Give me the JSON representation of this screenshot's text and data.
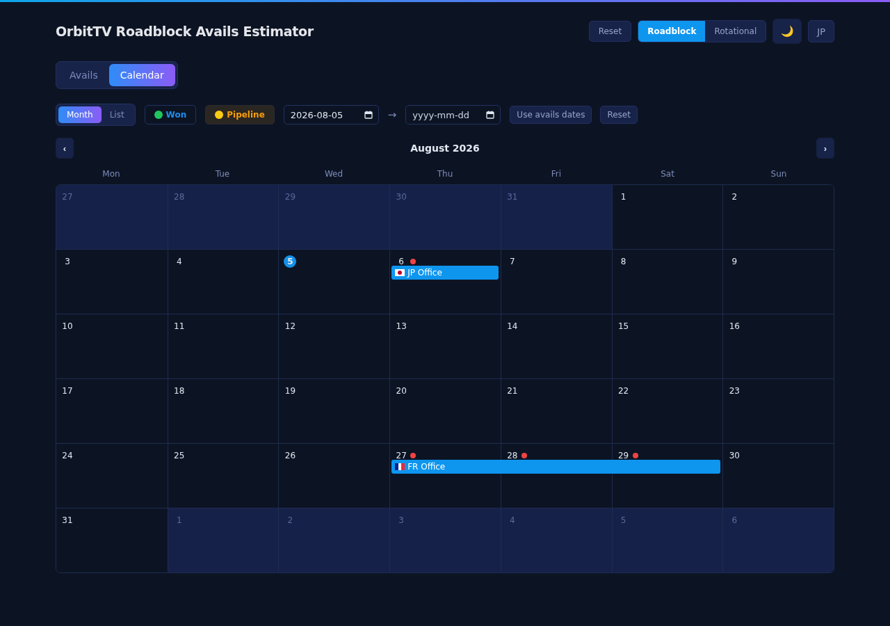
{
  "title": "OrbitTV Roadblock Avails Estimator",
  "header_actions": {
    "reset": "Reset",
    "modes": [
      {
        "label": "Roadblock",
        "selected": true
      },
      {
        "label": "Rotational",
        "selected": false
      }
    ],
    "theme_icon": "🌙",
    "language": "JP"
  },
  "main_tabs": [
    {
      "label": "Avails",
      "selected": false
    },
    {
      "label": "Calendar",
      "selected": true
    }
  ],
  "toolbar": {
    "views": [
      {
        "label": "Month",
        "selected": true
      },
      {
        "label": "List",
        "selected": false
      }
    ],
    "filters": [
      {
        "label": "Won",
        "color": "#22c55e",
        "kind": "won"
      },
      {
        "label": "Pipeline",
        "color": "#facc15",
        "kind": "pipeline"
      }
    ],
    "start_date": {
      "value": "2026-08-05"
    },
    "arrow": "→",
    "end_date": {
      "placeholder": "yyyy-mm-dd"
    },
    "use_avails": "Use avails dates",
    "reset": "Reset"
  },
  "calendar": {
    "prev": "‹",
    "next": "›",
    "month": "August 2026",
    "weekdays": [
      "Mon",
      "Tue",
      "Wed",
      "Thu",
      "Fri",
      "Sat",
      "Sun"
    ],
    "weeks": [
      {
        "days": [
          {
            "label": "27",
            "outside": true
          },
          {
            "label": "28",
            "outside": true
          },
          {
            "label": "29",
            "outside": true
          },
          {
            "label": "30",
            "outside": true
          },
          {
            "label": "31",
            "outside": true
          },
          {
            "label": "1",
            "outside": false
          },
          {
            "label": "2",
            "outside": false
          }
        ]
      },
      {
        "days": [
          {
            "label": "3",
            "outside": false
          },
          {
            "label": "4",
            "outside": false
          },
          {
            "label": "5",
            "outside": false,
            "today": true
          },
          {
            "label": "6",
            "outside": false,
            "marked": true
          },
          {
            "label": "7",
            "outside": false
          },
          {
            "label": "8",
            "outside": false
          },
          {
            "label": "9",
            "outside": false
          }
        ],
        "events": [
          {
            "label": "JP Office",
            "kind": "jp"
          }
        ]
      },
      {
        "days": [
          {
            "label": "10",
            "outside": false
          },
          {
            "label": "11",
            "outside": false
          },
          {
            "label": "12",
            "outside": false
          },
          {
            "label": "13",
            "outside": false
          },
          {
            "label": "14",
            "outside": false
          },
          {
            "label": "15",
            "outside": false
          },
          {
            "label": "16",
            "outside": false
          }
        ]
      },
      {
        "days": [
          {
            "label": "17",
            "outside": false
          },
          {
            "label": "18",
            "outside": false
          },
          {
            "label": "19",
            "outside": false
          },
          {
            "label": "20",
            "outside": false
          },
          {
            "label": "21",
            "outside": false
          },
          {
            "label": "22",
            "outside": false
          },
          {
            "label": "23",
            "outside": false
          }
        ]
      },
      {
        "days": [
          {
            "label": "24",
            "outside": false
          },
          {
            "label": "25",
            "outside": false
          },
          {
            "label": "26",
            "outside": false
          },
          {
            "label": "27",
            "outside": false,
            "marked": true
          },
          {
            "label": "28",
            "outside": false,
            "marked": true
          },
          {
            "label": "29",
            "outside": false,
            "marked": true
          },
          {
            "label": "30",
            "outside": false
          }
        ],
        "events": [
          {
            "label": "FR Office",
            "kind": "fr"
          }
        ]
      },
      {
        "days": [
          {
            "label": "31",
            "outside": false
          },
          {
            "label": "1",
            "outside": true
          },
          {
            "label": "2",
            "outside": true
          },
          {
            "label": "3",
            "outside": true
          },
          {
            "label": "4",
            "outside": true
          },
          {
            "label": "5",
            "outside": true
          },
          {
            "label": "6",
            "outside": true
          }
        ]
      }
    ]
  }
}
